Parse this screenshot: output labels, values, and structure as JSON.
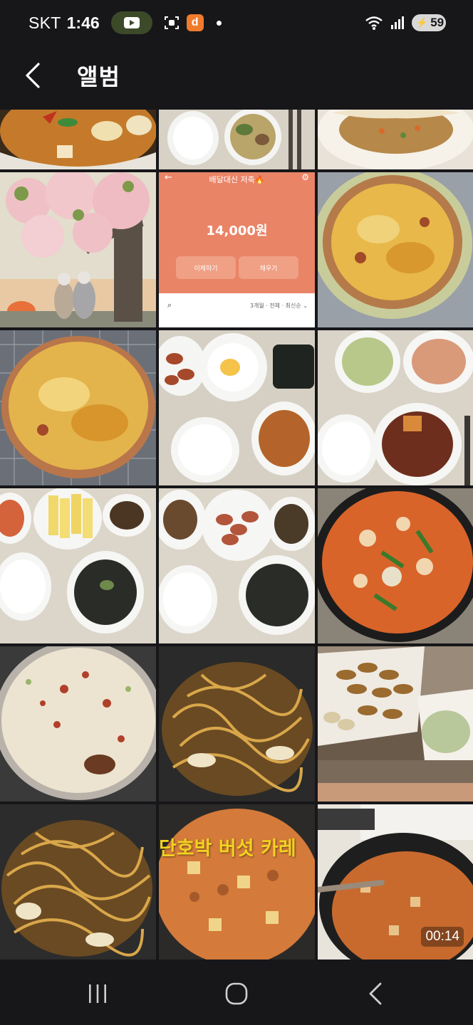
{
  "status_bar": {
    "carrier": "SKT",
    "time": "1:46",
    "battery": "59",
    "tiktok_glyph": "d"
  },
  "header": {
    "title": "앨범"
  },
  "bank_screenshot": {
    "title": "배달대신 저축🔥",
    "amount": "14,000원",
    "button_left": "이체하기",
    "button_right": "채우기",
    "filter": "3개월 · 전체 · 최신순 ⌄"
  },
  "video_overlay_text": "단호박 버섯 카레",
  "video_duration": "00:14",
  "colors": {
    "background": "#17171a",
    "bank_orange": "#e98466",
    "overlay_yellow": "#f2d221"
  },
  "photos": [
    {
      "name": "curry-dish"
    },
    {
      "name": "rice-and-soup-tray"
    },
    {
      "name": "omelette-fried-rice"
    },
    {
      "name": "embroidery-tree-couple"
    },
    {
      "name": "bank-app-screenshot"
    },
    {
      "name": "pizza-on-plate"
    },
    {
      "name": "pizza-on-rack"
    },
    {
      "name": "sausage-egg-tray"
    },
    {
      "name": "kimchi-braised-meat-tray"
    },
    {
      "name": "egg-roll-seaweed-soup-tray"
    },
    {
      "name": "sausage-seaweed-soup-tray"
    },
    {
      "name": "spicy-stew-pan"
    },
    {
      "name": "porridge-pot"
    },
    {
      "name": "fried-noodles-pan"
    },
    {
      "name": "fried-snacks-on-paper"
    },
    {
      "name": "fried-noodles-closeup"
    },
    {
      "name": "pumpkin-mushroom-curry-video"
    },
    {
      "name": "curry-pot-video"
    }
  ]
}
